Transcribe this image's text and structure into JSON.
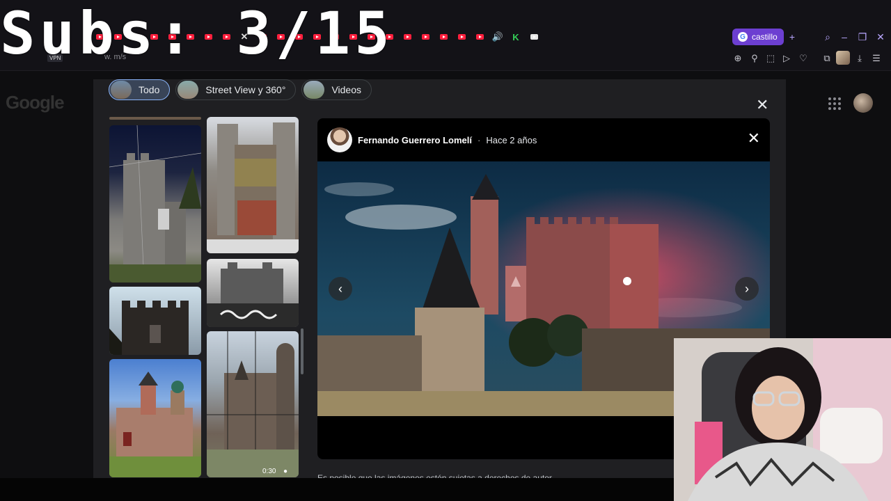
{
  "overlay": {
    "subs_text": "Subs: 3/15"
  },
  "browser": {
    "vpn_label": "VPN",
    "url_fragment": "w.          m/s",
    "active_tab": {
      "title": "castillo"
    },
    "new_tab_symbol": "+"
  },
  "page": {
    "logo_text": "Google"
  },
  "filters": {
    "chips": [
      {
        "label": "Todo",
        "active": true
      },
      {
        "label": "Street View y 360°",
        "active": false
      },
      {
        "label": "Videos",
        "active": false
      }
    ]
  },
  "viewer": {
    "author": "Fernando Guerrero Lomelí",
    "separator": "·",
    "posted": "Hace 2 años",
    "disclaimer": "Es posible que las imágenes estén sujetas a derechos de autor."
  },
  "thumbs": {
    "video_duration": "0:30"
  },
  "icons": {
    "close": "close-icon",
    "prev": "chevron-left-icon",
    "next": "chevron-right-icon",
    "apps": "apps-grid-icon"
  },
  "colors": {
    "accent_tab": "#6c3fd1",
    "chip_active": "#394457",
    "youtube_red": "#ff1f3d"
  }
}
